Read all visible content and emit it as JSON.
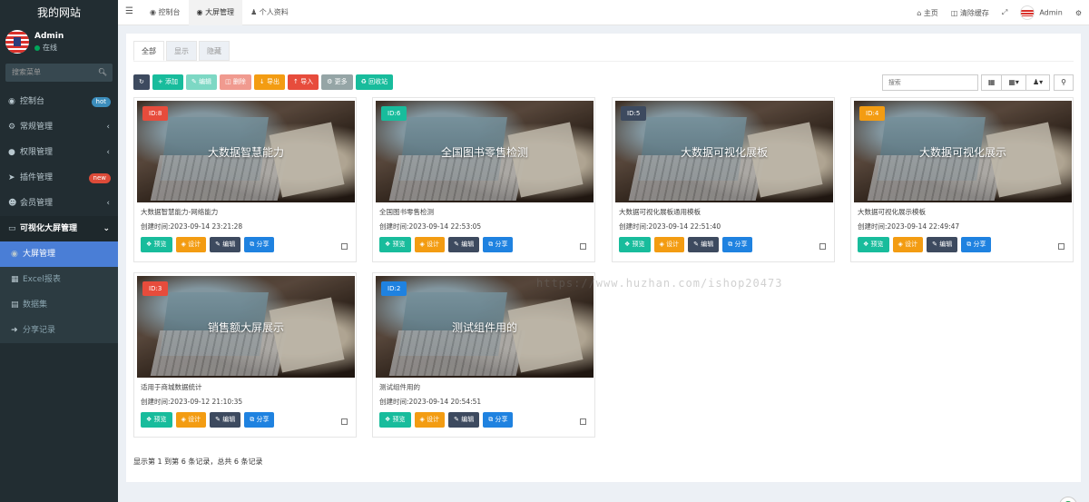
{
  "brand": "我的网站",
  "user": {
    "name": "Admin",
    "status": "在线"
  },
  "sidebar_search": {
    "placeholder": "搜索菜单"
  },
  "menu": [
    {
      "label": "控制台",
      "icon": "dashboard-icon",
      "badge": "hot"
    },
    {
      "label": "常规管理",
      "icon": "cogs-icon"
    },
    {
      "label": "权限管理",
      "icon": "group-icon"
    },
    {
      "label": "插件管理",
      "icon": "rocket-icon",
      "badge": "new"
    },
    {
      "label": "会员管理",
      "icon": "user-circle-icon"
    },
    {
      "label": "可视化大屏管理",
      "icon": "monitor-icon"
    }
  ],
  "submenu": [
    {
      "label": "大屏管理",
      "icon": "dashboard-icon"
    },
    {
      "label": "Excel报表",
      "icon": "table-icon"
    },
    {
      "label": "数据集",
      "icon": "list-icon"
    },
    {
      "label": "分享记录",
      "icon": "share-icon"
    }
  ],
  "topbar": {
    "tabs": [
      "控制台",
      "大屏管理",
      "个人资料"
    ],
    "right": {
      "home": "主页",
      "clear_cache": "清除缓存",
      "admin": "Admin"
    }
  },
  "filter_tabs": [
    "全部",
    "显示",
    "隐藏"
  ],
  "toolbar": {
    "add": "添加",
    "edit": "编辑",
    "delete": "删除",
    "export": "导出",
    "import": "导入",
    "more": "更多",
    "recycle": "回收站"
  },
  "search": {
    "placeholder": "搜索"
  },
  "card_buttons": {
    "preview": "预览",
    "design": "设计",
    "edit": "编辑",
    "share": "分享"
  },
  "cards": [
    {
      "id": "ID:8",
      "title": "大数据智慧能力",
      "desc": "大数据智慧能力-网络能力",
      "time": "创建时间:2023-09-14 23:21:28",
      "badge_color": "#e74c3c"
    },
    {
      "id": "ID:6",
      "title": "全国图书零售检测",
      "desc": "全国图书零售检测",
      "time": "创建时间:2023-09-14 22:53:05",
      "badge_color": "#18bc9c"
    },
    {
      "id": "ID:5",
      "title": "大数据可视化展板",
      "desc": "大数据可视化展板通用模板",
      "time": "创建时间:2023-09-14 22:51:40",
      "badge_color": "#3d4a5f"
    },
    {
      "id": "ID:4",
      "title": "大数据可视化展示",
      "desc": "大数据可视化展示模板",
      "time": "创建时间:2023-09-14 22:49:47",
      "badge_color": "#f39c12"
    },
    {
      "id": "ID:3",
      "title": "销售额大屏展示",
      "desc": "适用于商城数据统计",
      "time": "创建时间:2023-09-12 21:10:35",
      "badge_color": "#e74c3c"
    },
    {
      "id": "ID:2",
      "title": "测试组件用的",
      "desc": "测试组件用的",
      "time": "创建时间:2023-09-14 20:54:51",
      "badge_color": "#1f82e0"
    }
  ],
  "record_info": "显示第 1 到第 6 条记录，总共 6 条记录",
  "watermark": "https://www.huzhan.com/ishop20473"
}
